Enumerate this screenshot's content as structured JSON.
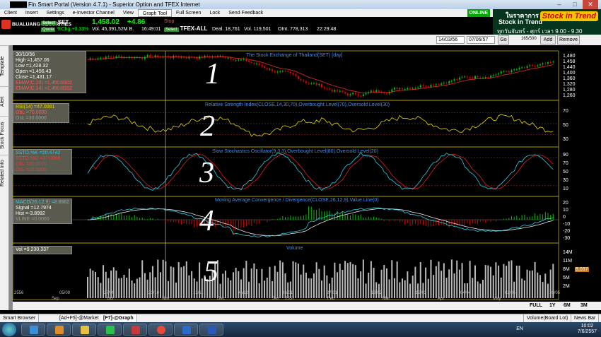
{
  "window": {
    "title": "Fin Smart Portal (Version 4.7.1) - Superior Option and TFEX Internet",
    "controls": [
      "–",
      "□",
      "✕"
    ]
  },
  "menu": {
    "items": [
      "Client",
      "Insert",
      "Settings",
      "e-Investor Channel",
      "View",
      "Graph Tool",
      "Full Screen",
      "Lock",
      "Send Feedback"
    ],
    "online": "ONLINE"
  },
  "banner": {
    "line1": "ในราคาการ",
    "line2": "Stock in Trend",
    "line3": "ทุกวันจันทร์ - ศุกร์ เวลา 9.00 - 9.30",
    "logo": "Stock in Trend"
  },
  "quote": {
    "broker": "BUALUANG SECURITIES",
    "symbol": "SET",
    "last": "1,458.02",
    "change": "+4.86",
    "pct": "%Chg.+0.33%",
    "vol": "Vol. 45,391,52M B.",
    "time": "16:49:01",
    "stop": "Stop",
    "tfex_symbol": "TFEX-ALL",
    "tfex_deal": "Deal. 18,761",
    "tfex_vol": "Vol. 119,501",
    "tfex_oint": "OInt. 778,313",
    "tfex_time": "22:29:48",
    "tag_select": "Select",
    "tag_quote": "Quote",
    "tag_volume": "Volume"
  },
  "toolbar": {
    "date_from": "14/03/56",
    "date_to": "07/06/57",
    "go": "Go",
    "scale": "165/500",
    "add": "Add",
    "remove": "Remove"
  },
  "leftbar": [
    "Template",
    "Alert",
    "Stock Focus",
    "Related Info"
  ],
  "panels": {
    "p1": {
      "title": "The Stock Exchange of Thailand(SET) [day]",
      "info": [
        "30/10/56",
        "High   =1,457.06",
        "Low    =1,428.32",
        "Open   =1,456.43",
        "Close  =1,431.17",
        "EMAV(C,10) =1,450.8102",
        "EMAV(C,14) =1,450.8162"
      ],
      "yticks": [
        "1,480",
        "1,458",
        "1,440",
        "1,400",
        "1,360",
        "1,320",
        "1,280",
        "1,260"
      ],
      "number": "1"
    },
    "p2": {
      "title": "Relative Strength Index(CLOSE,14,30,70),Overbought Level(70),Oversold Level(30)",
      "info": [
        "RSI(14)   =47.0081",
        "ObL    =70.0000",
        "OsL    =30.0000"
      ],
      "yticks": [
        "70",
        "50",
        "30"
      ],
      "number": "2"
    },
    "p3": {
      "title": "Slow Stochastics Oscillator(9,3,3),Overbought Level(80),Oversold Level(20)",
      "info": [
        "SSTO.%K   =20.4742",
        "SSTO.%D   =37.0000",
        "ObL    =80.0000",
        "OsL    =20.0000"
      ],
      "yticks": [
        "90",
        "70",
        "50",
        "30",
        "10"
      ],
      "number": "3"
    },
    "p4": {
      "title": "Moving Average Convergence / Divergence(CLOSE,26,12,9),Value Line(0)",
      "info": [
        "MACD(26,12,9)  =8.8982",
        "Signal  =12.7974",
        "Hist    =-3.8992",
        "VLINE   =0.0000"
      ],
      "yticks": [
        "20",
        "10",
        "0",
        "-10",
        "-20",
        "-30"
      ],
      "number": "4"
    },
    "p5": {
      "title": "Volume",
      "info": [
        "Vol   =9,230,337"
      ],
      "yticks": [
        "14M",
        "11M",
        "8M",
        "5M",
        "2M"
      ],
      "last": "8,037",
      "number": "5"
    }
  },
  "xaxis": {
    "years": [
      "2556",
      "2557"
    ],
    "dates": [
      "05/09",
      "27/09",
      "21/10",
      "13/11",
      "06/12",
      "03/01",
      "27/01",
      "19/02",
      "13/03",
      "04/04",
      "02/05",
      "20/05"
    ],
    "months": [
      "Sep",
      "Oct",
      "Nov",
      "Dec",
      "Jan",
      "Feb",
      "Mar",
      "Apr",
      "May"
    ]
  },
  "periods": [
    "FULL",
    "1Y",
    "6M",
    "3M"
  ],
  "tabs": [
    "Smart Browser",
    "[Ad+F5]-@Market",
    "[F7]-@Graph"
  ],
  "statusright": [
    "Volume(Board Lot)",
    "News Bar"
  ],
  "clock": {
    "time": "10:02",
    "date": "7/6/2557",
    "lang": "EN"
  },
  "colors": {
    "up": "#00c000",
    "down": "#e00000",
    "rsi": "#e8d800",
    "k": "#2ad0e8",
    "d": "#e02020",
    "macd": "#2ad0e8",
    "signal": "#e8e8e8",
    "title": "#4a8ce8"
  }
}
